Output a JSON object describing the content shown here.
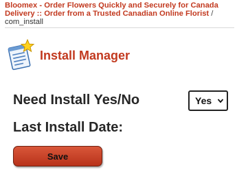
{
  "breadcrumb": {
    "link_text": "Bloomex - Order Flowers Quickly and Securely for Canada Delivery :: Order from a Trusted Canadian Online Florist",
    "separator": "/",
    "current": "com_install"
  },
  "header": {
    "icon": "install-manager-icon",
    "title": "Install Manager"
  },
  "form": {
    "need_install_label": "Need Install Yes/No",
    "need_install_value": "Yes",
    "last_install_label": "Last Install Date:",
    "save_label": "Save"
  },
  "colors": {
    "accent": "#c2391f",
    "button": "#c8442a",
    "text": "#262626"
  }
}
